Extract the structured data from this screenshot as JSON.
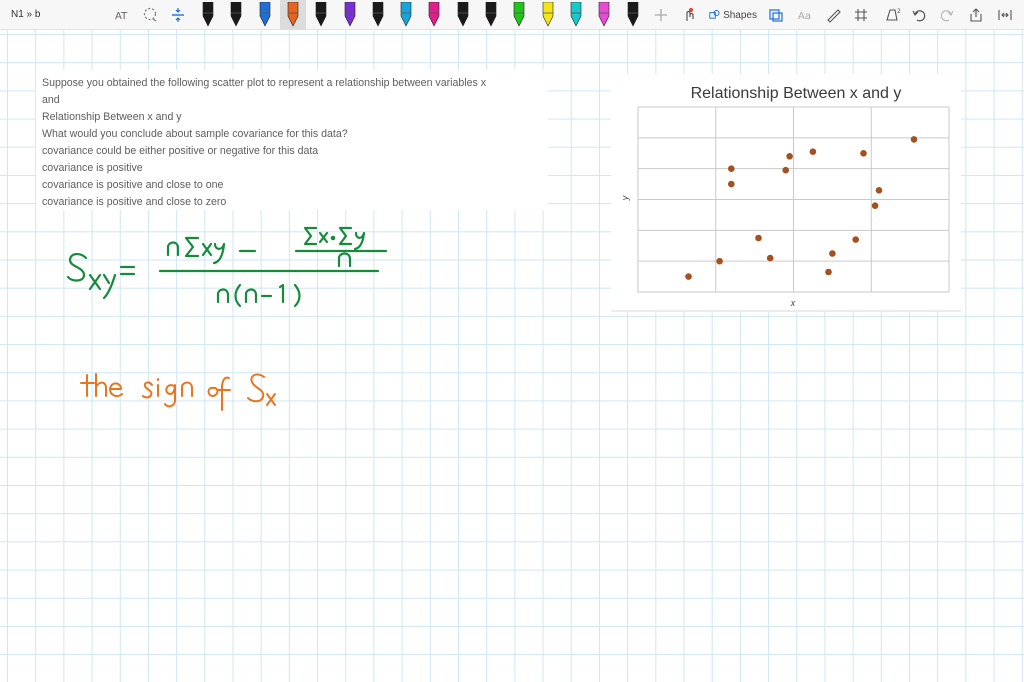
{
  "app": {
    "page_title": "N1 » b"
  },
  "toolbar": {
    "shapes_label": "Shapes",
    "tools": [
      "lasso-select",
      "add-space",
      "type-text",
      "shapes",
      "ruler",
      "undo",
      "redo"
    ],
    "pen_colors": [
      "#1a1a1a",
      "#1a1a1a",
      "#1f6fd6",
      "#e8641c",
      "#1a1a1a",
      "#7a2fd6",
      "#1a1a1a",
      "#1aa3d6",
      "#e01f8a",
      "#1a1a1a",
      "#1a1a1a",
      "#22c41a",
      "#f2e61a",
      "#19c9c9",
      "#e84bd6",
      "#1a1a1a"
    ]
  },
  "question": {
    "lines": [
      "Suppose you obtained the following scatter plot to represent a relationship between variables x",
      "and",
      "Relationship Between x and y",
      "What would you conclude about sample covariance for this data?",
      "covariance could be either positive or negative for this data",
      "covariance is positive",
      "covariance is positive and close to one",
      "covariance is positive and close to zero"
    ]
  },
  "chart_data": {
    "type": "scatter",
    "title": "Relationship Between x and y",
    "xlabel": "x",
    "ylabel": "y",
    "grid": true,
    "xlim": [
      0,
      4
    ],
    "ylim": [
      0,
      6
    ],
    "x": [
      0.65,
      1.05,
      1.2,
      1.2,
      1.55,
      1.7,
      1.9,
      1.95,
      2.25,
      2.45,
      2.5,
      2.8,
      2.9,
      3.05,
      3.1,
      3.55
    ],
    "y": [
      0.5,
      1.0,
      3.5,
      4.0,
      1.75,
      1.1,
      3.95,
      4.4,
      4.55,
      0.65,
      1.25,
      1.7,
      4.5,
      2.8,
      3.3,
      4.95
    ],
    "marker_color": "#a4501f"
  },
  "handwriting": {
    "formula_color": "#168b3c",
    "note_color": "#e8761f",
    "formula_lhs": "Sxy =",
    "formula_numerator": "nΣxy − Σx·Σy/n",
    "formula_denominator": "n(n−1)",
    "note": "the sign of Sx"
  }
}
